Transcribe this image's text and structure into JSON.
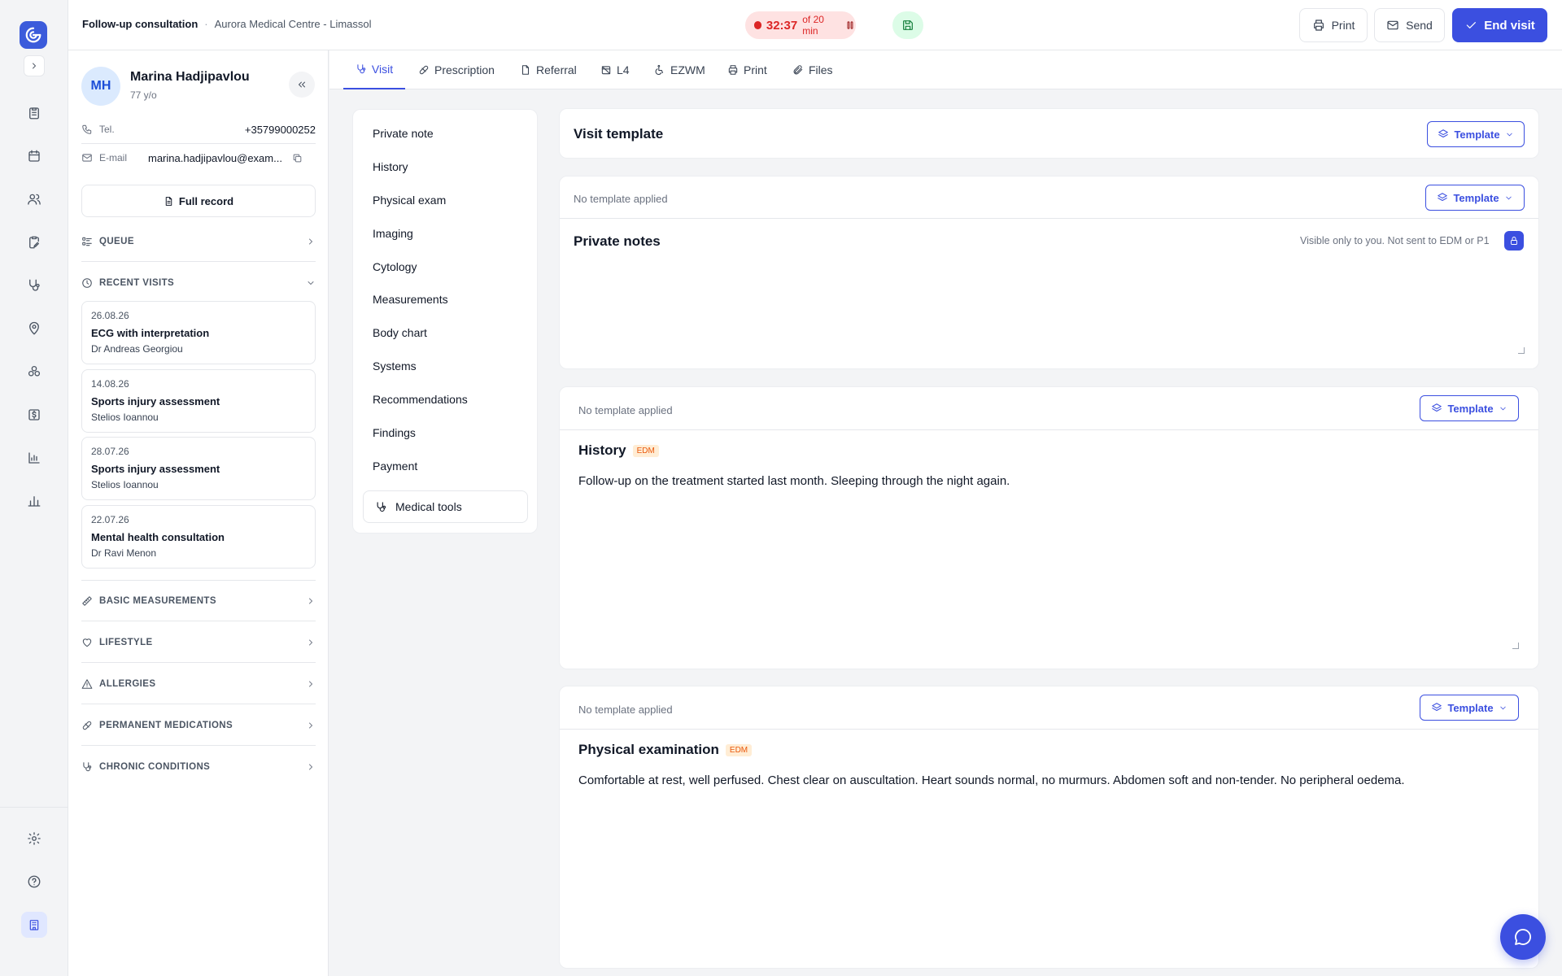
{
  "header": {
    "visit_type": "Follow-up consultation",
    "separator": "·",
    "location": "Aurora Medical Centre - Limassol",
    "timer_elapsed": "32:37",
    "timer_limit": "of 20 min",
    "print_label": "Print",
    "send_label": "Send",
    "end_visit_label": "End visit"
  },
  "patient": {
    "initials": "MH",
    "name": "Marina Hadjipavlou",
    "age": "77 y/o",
    "tel_label": "Tel.",
    "tel": "+35799000252",
    "email_label": "E-mail",
    "email": "marina.hadjipavlou@exam...",
    "full_record_label": "Full record",
    "queue_label": "QUEUE",
    "recent_visits_label": "RECENT VISITS",
    "recent_visits": [
      {
        "date": "26.08.26",
        "title": "ECG with interpretation",
        "doctor": "Dr Andreas Georgiou"
      },
      {
        "date": "14.08.26",
        "title": "Sports injury assessment",
        "doctor": "Stelios Ioannou"
      },
      {
        "date": "28.07.26",
        "title": "Sports injury assessment",
        "doctor": "Stelios Ioannou"
      },
      {
        "date": "22.07.26",
        "title": "Mental health consultation",
        "doctor": "Dr Ravi Menon"
      }
    ],
    "sections": [
      "BASIC MEASUREMENTS",
      "LIFESTYLE",
      "ALLERGIES",
      "PERMANENT MEDICATIONS",
      "CHRONIC CONDITIONS"
    ]
  },
  "tabs": [
    "Visit",
    "Prescription",
    "Referral",
    "L4",
    "EZWM",
    "Print",
    "Files"
  ],
  "section_nav": [
    "Private note",
    "History",
    "Physical exam",
    "Imaging",
    "Cytology",
    "Measurements",
    "Body chart",
    "Systems",
    "Recommendations",
    "Findings",
    "Payment"
  ],
  "medical_tools_label": "Medical tools",
  "visit_template": {
    "title": "Visit template",
    "button": "Template"
  },
  "private_notes": {
    "template_status": "No template applied",
    "button": "Template",
    "title": "Private notes",
    "visibility": "Visible only to you. Not sent to EDM or P1"
  },
  "history": {
    "template_status": "No template applied",
    "button": "Template",
    "title": "History",
    "badge": "EDM",
    "text": "Follow-up on the treatment started last month. Sleeping through the night again."
  },
  "physical": {
    "template_status": "No template applied",
    "button": "Template",
    "title": "Physical examination",
    "badge": "EDM",
    "text": "Comfortable at rest, well perfused. Chest clear on auscultation. Heart sounds normal, no murmurs. Abdomen soft and non-tender. No peripheral oedema."
  },
  "colors": {
    "accent": "#3b4fe0",
    "timer": "#dc2626",
    "save": "#15803d",
    "edm": "#ea580c"
  }
}
